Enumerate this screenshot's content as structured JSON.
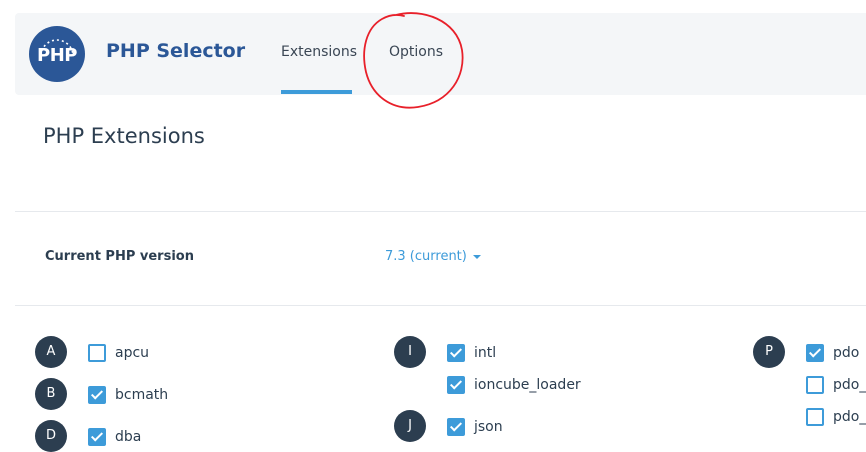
{
  "app": {
    "logo_text": "PHP",
    "title": "PHP Selector"
  },
  "tabs": [
    {
      "label": "Extensions",
      "active": true
    },
    {
      "label": "Options",
      "active": false
    }
  ],
  "page_title": "PHP Extensions",
  "version": {
    "label": "Current PHP version",
    "value": "7.3 (current)"
  },
  "columns": [
    {
      "groups": [
        {
          "letter": "A",
          "items": [
            {
              "name": "apcu",
              "checked": false
            }
          ]
        },
        {
          "letter": "B",
          "items": [
            {
              "name": "bcmath",
              "checked": true
            }
          ]
        },
        {
          "letter": "D",
          "items": [
            {
              "name": "dba",
              "checked": true
            }
          ]
        }
      ]
    },
    {
      "groups": [
        {
          "letter": "I",
          "items": [
            {
              "name": "intl",
              "checked": true
            },
            {
              "name": "ioncube_loader",
              "checked": true
            }
          ]
        },
        {
          "letter": "J",
          "items": [
            {
              "name": "json",
              "checked": true
            }
          ]
        }
      ]
    },
    {
      "groups": [
        {
          "letter": "P",
          "items": [
            {
              "name": "pdo",
              "checked": true
            },
            {
              "name": "pdo_d",
              "checked": false
            },
            {
              "name": "pdo_f",
              "checked": false
            }
          ]
        }
      ]
    }
  ],
  "colors": {
    "accent": "#3d9bd9",
    "brand": "#2b5797",
    "letter_badge": "#2c3e50",
    "annotation": "#e8202a"
  }
}
